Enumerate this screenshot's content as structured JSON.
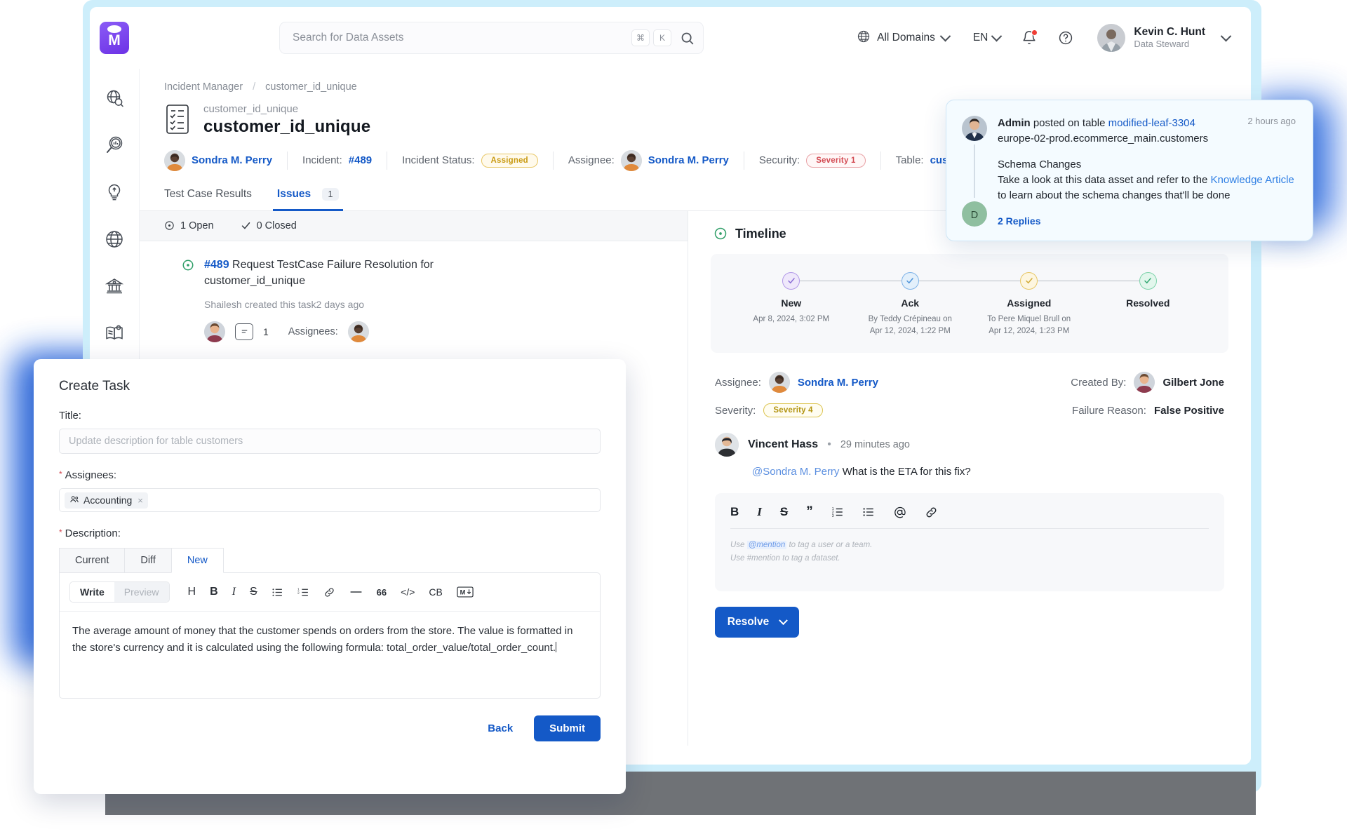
{
  "header": {
    "logo_icon": "openmetadata-logo",
    "search": {
      "placeholder": "Search for Data Assets",
      "kbd1": "⌘",
      "kbd2": "K",
      "icon": "search-icon"
    },
    "domain": {
      "label": "All Domains",
      "icon": "globe-icon"
    },
    "language": {
      "label": "EN"
    },
    "notifications_icon": "bell-icon",
    "help_icon": "help-circle-icon",
    "user": {
      "name": "Kevin C. Hunt",
      "role": "Data Steward"
    }
  },
  "rail": {
    "items": [
      {
        "icon": "explore-globe-search-icon"
      },
      {
        "icon": "insights-magnifier-icon"
      },
      {
        "icon": "lightbulb-icon"
      },
      {
        "icon": "globe-icon"
      },
      {
        "icon": "governance-bank-icon"
      },
      {
        "icon": "glossary-book-icon"
      }
    ]
  },
  "breadcrumb": {
    "root": "Incident Manager",
    "separator": "/",
    "current": "customer_id_unique"
  },
  "page": {
    "icon": "test-case-doc-icon",
    "subtitle": "customer_id_unique",
    "title": "customer_id_unique"
  },
  "meta": {
    "owner": "Sondra M. Perry",
    "incident_label": "Incident:",
    "incident_value": "#489",
    "status_label": "Incident Status:",
    "status_value": "Assigned",
    "assignee_label": "Assignee:",
    "assignee_value": "Sondra M. Perry",
    "security_label": "Security:",
    "security_value": "Severity 1",
    "table_label": "Table:",
    "table_value": "customers"
  },
  "tabs": [
    {
      "label": "Test Case Results",
      "badge": "",
      "active": false
    },
    {
      "label": "Issues",
      "badge": "1",
      "active": true
    }
  ],
  "issues": {
    "open_count": "1 Open",
    "closed_count": "0 Closed",
    "open_icon": "open-circle-icon",
    "closed_icon": "check-icon",
    "item": {
      "id": "#489",
      "title": "Request TestCase Failure Resolution for customer_id_unique",
      "meta": "Shailesh created this task2 days ago",
      "comment_count": "1",
      "assignees_label": "Assignees:"
    }
  },
  "timeline": {
    "icon": "timeline-circle-icon",
    "title": "Timeline",
    "steps": [
      {
        "name": "New",
        "detail": "Apr 8, 2024, 3:02 PM",
        "color": "#b39ae8"
      },
      {
        "name": "Ack",
        "detail": "By Teddy Crépineau on\nApr 12, 2024, 1:22 PM",
        "color": "#7eb3e8"
      },
      {
        "name": "Assigned",
        "detail": "To Pere Miquel Brull  on\nApr 12, 2024, 1:23 PM",
        "color": "#e8c766"
      },
      {
        "name": "Resolved",
        "detail": "",
        "color": "#7fd3ab"
      }
    ],
    "assignee_label": "Assignee:",
    "assignee_value": "Sondra M. Perry",
    "created_by_label": "Created By:",
    "created_by_value": "Gilbert Jone",
    "severity_label": "Severity:",
    "severity_value": "Severity 4",
    "failure_label": "Failure Reason:",
    "failure_value": "False Positive"
  },
  "comment": {
    "author": "Vincent Hass",
    "separator": "•",
    "time": "29 minutes ago",
    "mention": "@Sondra M. Perry",
    "text": "What is the ETA for this fix?"
  },
  "comment_editor": {
    "tools": [
      "bold-icon",
      "italic-icon",
      "strikethrough-icon",
      "quote-icon",
      "ordered-list-icon",
      "bullet-list-icon",
      "mention-at-icon",
      "link-icon"
    ],
    "hint_line1_a": "Use",
    "hint_line1_m": "@mention",
    "hint_line1_b": "to tag a user or a team.",
    "hint_line2": "Use #mention to tag a dataset."
  },
  "resolve_button": {
    "label": "Resolve"
  },
  "notification": {
    "author": "Admin",
    "action": "posted on table",
    "table_link": "modified-leaf-3304",
    "fqn": "europe-02-prod.ecommerce_main.customers",
    "time": "2 hours ago",
    "subject": "Schema Changes",
    "body_a": "Take a look at this data asset and refer to the",
    "body_link": "Knowledge Article",
    "body_b": "to learn about the schema changes that'll be done",
    "replies": "2 Replies",
    "reply_avatar_initial": "D"
  },
  "modal": {
    "title": "Create Task",
    "title_field_label": "Title:",
    "title_field_placeholder": "Update description for table customers",
    "assignees_label": "Assignees:",
    "assignee_chip": "Accounting",
    "assignee_chip_remove": "×",
    "assignee_chip_icon": "team-icon",
    "description_label": "Description:",
    "desc_tabs": [
      {
        "label": "Current",
        "active": false
      },
      {
        "label": "Diff",
        "active": false
      },
      {
        "label": "New",
        "active": true
      }
    ],
    "write_label": "Write",
    "preview_label": "Preview",
    "md_tools": [
      "heading-icon",
      "bold-icon",
      "italic-icon",
      "strikethrough-icon",
      "bullet-list-icon",
      "ordered-list-icon",
      "link-icon",
      "divider-icon",
      "quote-icon",
      "code-icon",
      "code-block-icon",
      "markdown-icon"
    ],
    "description_text": "The average amount of money that the customer spends on orders from the store. The value is formatted in the store's currency and it is calculated using the following formula: total_order_value/total_order_count.",
    "back_label": "Back",
    "submit_label": "Submit"
  },
  "colors": {
    "primary": "#1459c7",
    "danger": "#d34b53",
    "warning": "#c99a12",
    "success": "#2f9e68"
  }
}
